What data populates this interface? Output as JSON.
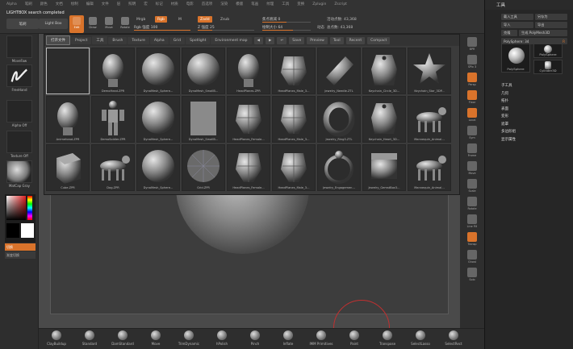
{
  "menubar": {
    "items": [
      "Alpha",
      "笔刷",
      "颜色",
      "文档",
      "绘制",
      "编辑",
      "文件",
      "层",
      "照明",
      "宏",
      "标记",
      "材质",
      "电影",
      "首选项",
      "渲染",
      "模版",
      "笔画",
      "纹理",
      "工具",
      "变换",
      "Zplugin",
      "Zscript"
    ]
  },
  "topbar": {
    "notification": "LIGHTBOX search completed",
    "lightbox_button": "Light Box",
    "quicksave_button": "Light Box",
    "tools": [
      {
        "label": "Sketch",
        "active": false
      },
      {
        "label": "Edit",
        "active": true
      },
      {
        "label": "Draw",
        "active": false
      },
      {
        "label": "Move",
        "active": false
      },
      {
        "label": "Scale",
        "active": false
      },
      {
        "label": "Rotate",
        "active": false
      }
    ],
    "mrgb": "Mrgb",
    "rgb": "Rgb",
    "m": "M",
    "zadd": "Zadd",
    "zsub": "Zsub",
    "rgb_intensity_label": "Rgb 强度",
    "rgb_intensity_value": "100",
    "z_intensity_label": "Z 强度",
    "z_intensity_value": "25",
    "focal_label": "焦点衰减",
    "focal_value": "0",
    "draw_size_label": "绘制大小",
    "draw_size_value": "64",
    "dynamic_label": "动态",
    "active_points_label": "活动点数",
    "active_points_value": "43,368",
    "total_points_label": "总点数",
    "total_points_value": "43,368"
  },
  "leftshelf": {
    "brush1": "MoveFaw",
    "brush2": "FreeHand",
    "brush3": "Alpha Off",
    "brush4": "Texture Off",
    "brush5": "MatCap Gray",
    "swatch_label": "切换",
    "gradient_label": "渐变切换"
  },
  "lightbox": {
    "tabs": [
      "打开文件",
      "Project",
      "工具",
      "Brush",
      "Texture",
      "Alpha",
      "Grid",
      "Spotlight",
      "Environment map"
    ],
    "nav": [
      "◀",
      "▶",
      "↩"
    ],
    "controls": [
      "Save",
      "Preview",
      "Tool",
      "Recent",
      "Compact"
    ],
    "cells": [
      "",
      "DemoHead.ZPR",
      "DynaMesh_Sphere...",
      "DynaMesh_SmallB...",
      "HeadPlanes.ZPR",
      "HeadPlanes_Male_3...",
      "Jewelry_Needle.ZTL",
      "Keychain_Circle_3D...",
      "Keychain_Star_3DP...",
      "Animehead.ZPR",
      "DemoSoldier.ZPR",
      "DynaMesh_Sphere...",
      "DynaMesh_SmallB...",
      "HeadPlanes_Female...",
      "HeadPlanes_Male_3...",
      "Jewelry_Ring3.ZTL",
      "Keychain_Heart_3D...",
      "Mannequin_Animal...",
      "Cube.ZPR",
      "Dog.ZPR",
      "DynaMesh_Sphere...",
      "Grid.ZPR",
      "HeadPlanes_Female...",
      "HeadPlanes_Male_3...",
      "Jewelry_Engagemen...",
      "Jewelry_GemstBox3...",
      "Mannequin_Animal..."
    ]
  },
  "rightshelf": {
    "buttons": [
      "BPR",
      "SPix 3",
      "Persp",
      "Floor",
      "Local",
      "Sym",
      "Frame",
      "Move",
      "Scale",
      "Rotate",
      "Line Fill",
      "Transp",
      "Ghost",
      "Solo"
    ]
  },
  "bottombar": {
    "brushes": [
      "ClayBuildup",
      "Standard",
      "DamStandard",
      "Move",
      "TrimDynamic",
      "hPolish",
      "Pinch",
      "Inflate",
      "IMM Primitives",
      "Paint",
      "Transpose",
      "SelectLasso",
      "SelectRect"
    ]
  },
  "rightpanel": {
    "title": "工具",
    "load_tool": "载入工具",
    "save_as": "另存为",
    "copy_tool": "拷贝工具",
    "import": "导入",
    "export": "导出",
    "clone": "克隆",
    "make_polymesh": "生成 PolyMesh3D",
    "active_tool": "PolySphere: 34",
    "thumb1": "PolySphere",
    "thumb2": "PolySphere",
    "thumb3": "Cylinder3D",
    "items": [
      "子工具",
      "几何",
      "拓扑",
      "表面",
      "变形",
      "遮罩",
      "多边形组",
      "显示属性"
    ]
  }
}
